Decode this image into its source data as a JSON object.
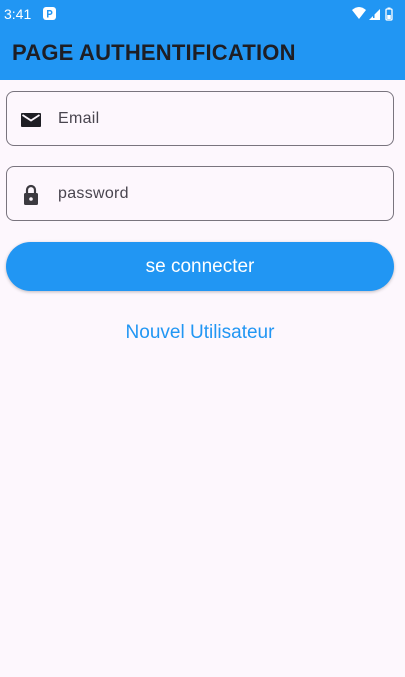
{
  "status_bar": {
    "time": "3:41"
  },
  "app_bar": {
    "title": "PAGE AUTHENTIFICATION"
  },
  "form": {
    "email_placeholder": "Email",
    "password_placeholder": "password",
    "connect_label": "se connecter",
    "new_user_label": "Nouvel Utilisateur"
  },
  "icons": {
    "email": "mail-icon",
    "password": "lock-icon"
  },
  "colors": {
    "primary": "#2196f3",
    "background": "#fdf7fd",
    "title_text": "#1e1e24",
    "outline": "#79747e"
  }
}
